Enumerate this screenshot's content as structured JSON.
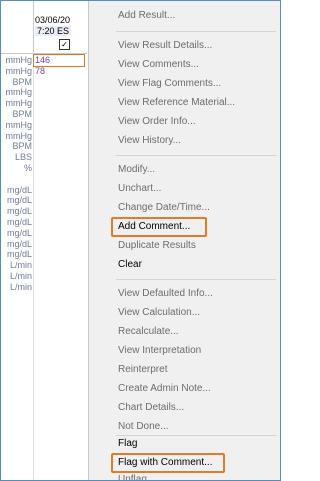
{
  "grid": {
    "header_date": "03/06/20",
    "header_time": "7:20 ES",
    "checkbox_mark": "✓",
    "units": [
      "mmHg",
      "mmHg",
      "BPM",
      "mmHg",
      "mmHg",
      "BPM",
      "mmHg",
      "mmHg",
      "BPM",
      "LBS",
      "%",
      "",
      "mg/dL",
      "mg/dL",
      "mg/dL",
      "mg/dL",
      "mg/dL",
      "mg/dL",
      "mg/dL",
      "L/min",
      "L/min",
      "L/min"
    ],
    "values": [
      "146",
      "78"
    ]
  },
  "menu": {
    "items": [
      {
        "label": "Add Result...",
        "enabled": false
      },
      {
        "label": "View Result Details...",
        "enabled": false
      },
      {
        "label": "View Comments...",
        "enabled": false
      },
      {
        "label": "View Flag Comments...",
        "enabled": false
      },
      {
        "label": "View Reference Material...",
        "enabled": false
      },
      {
        "label": "View Order Info...",
        "enabled": false
      },
      {
        "label": "View History...",
        "enabled": false
      },
      {
        "label": "Modify...",
        "enabled": false
      },
      {
        "label": "Unchart...",
        "enabled": false
      },
      {
        "label": "Change Date/Time...",
        "enabled": false
      },
      {
        "label": "Add Comment...",
        "enabled": true
      },
      {
        "label": "Duplicate Results",
        "enabled": false
      },
      {
        "label": "Clear",
        "enabled": true
      },
      {
        "label": "View Defaulted Info...",
        "enabled": false
      },
      {
        "label": "View Calculation...",
        "enabled": false
      },
      {
        "label": "Recalculate...",
        "enabled": false
      },
      {
        "label": "View Interpretation",
        "enabled": false
      },
      {
        "label": "Reinterpret",
        "enabled": false
      },
      {
        "label": "Create Admin Note...",
        "enabled": false
      },
      {
        "label": "Chart Details...",
        "enabled": false
      },
      {
        "label": "Not Done...",
        "enabled": false
      },
      {
        "label": "Flag",
        "enabled": true
      },
      {
        "label": "Flag with Comment...",
        "enabled": true
      },
      {
        "label": "Unflag",
        "enabled": false
      }
    ],
    "highlight_color": "#e07b2a"
  }
}
